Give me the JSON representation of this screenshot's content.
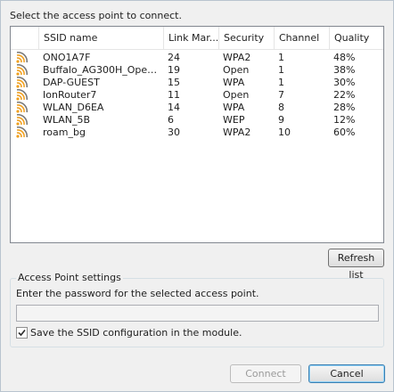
{
  "dialog": {
    "prompt": "Select the access point to connect."
  },
  "table": {
    "columns": [
      "",
      "SSID name",
      "Link Mar...",
      "Security",
      "Channel",
      "Quality"
    ],
    "rows": [
      {
        "ssid": "ONO1A7F",
        "link": "24",
        "security": "WPA2",
        "channel": "1",
        "quality": "48%"
      },
      {
        "ssid": "Buffalo_AG300H_Open_...",
        "link": "19",
        "security": "Open",
        "channel": "1",
        "quality": "38%"
      },
      {
        "ssid": "DAP-GUEST",
        "link": "15",
        "security": "WPA",
        "channel": "1",
        "quality": "30%"
      },
      {
        "ssid": "IonRouter7",
        "link": "11",
        "security": "Open",
        "channel": "7",
        "quality": "22%"
      },
      {
        "ssid": "WLAN_D6EA",
        "link": "14",
        "security": "WPA",
        "channel": "8",
        "quality": "28%"
      },
      {
        "ssid": "WLAN_5B",
        "link": "6",
        "security": "WEP",
        "channel": "9",
        "quality": "12%"
      },
      {
        "ssid": "roam_bg",
        "link": "30",
        "security": "WPA2",
        "channel": "10",
        "quality": "60%"
      }
    ]
  },
  "refresh_label": "Refresh list",
  "settings": {
    "title": "Access Point settings",
    "instruction": "Enter the password for the selected access point.",
    "password_value": "",
    "save_ssid_label": "Save the SSID configuration in the module.",
    "save_ssid_checked": true
  },
  "buttons": {
    "connect": "Connect",
    "cancel": "Cancel"
  },
  "icons": {
    "row_icon": "wifi-signal-icon",
    "check": "checkmark-icon"
  },
  "colors": {
    "signal": "#f0a020",
    "signal_dim": "#7a7a7a"
  }
}
